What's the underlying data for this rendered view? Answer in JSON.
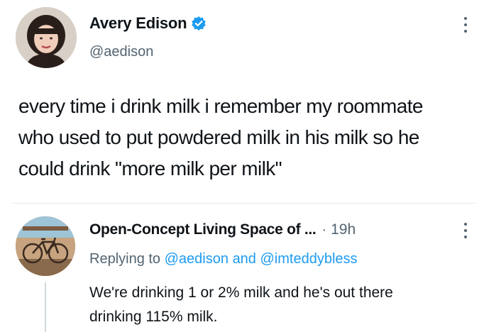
{
  "tweet": {
    "author": {
      "name": "Avery Edison",
      "handle": "@aedison",
      "verified": true
    },
    "text_lines": [
      "every time i drink milk i remember my roommate",
      "who used to put powdered milk in his milk so he",
      "could drink \"more milk per milk\""
    ]
  },
  "reply": {
    "author": {
      "name": "Open-Concept Living Space of ...",
      "time": "19h"
    },
    "separator": "·",
    "replying_prefix": "Replying to",
    "mentions": [
      "@aedison",
      "@imteddybless"
    ],
    "conjunction": "and",
    "text_lines": [
      "We're drinking 1 or 2% milk and he's out there",
      "drinking 115% milk."
    ]
  },
  "colors": {
    "accent": "#1d9bf0",
    "secondary_text": "#536471"
  },
  "icons": {
    "verified": "verified-badge-icon",
    "more": "more-options-icon"
  }
}
